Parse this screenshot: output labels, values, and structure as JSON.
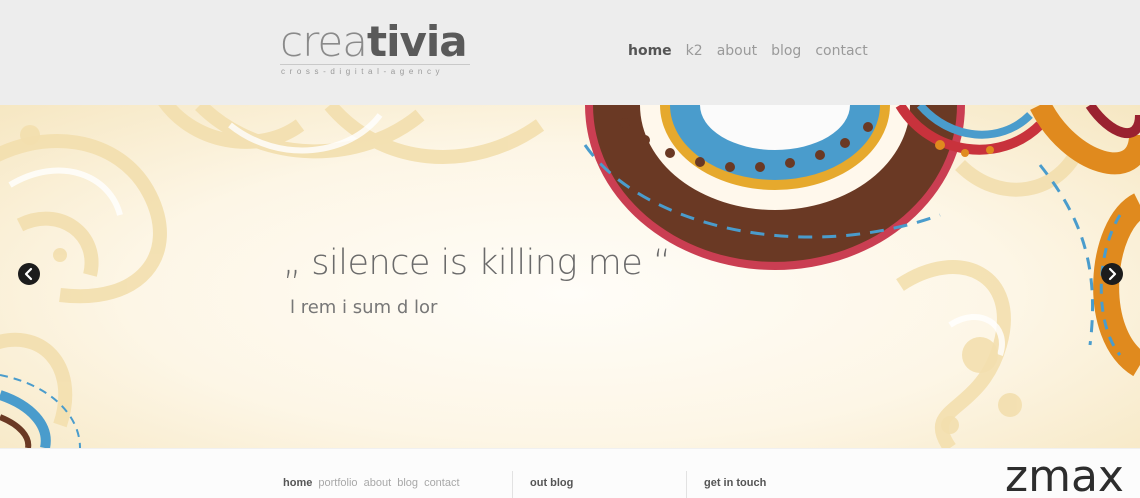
{
  "header": {
    "logo_light": "crea",
    "logo_bold": "tivia",
    "tagline": "cross-digital-agency"
  },
  "nav": {
    "items": [
      {
        "label": "home",
        "active": true
      },
      {
        "label": "k2",
        "active": false
      },
      {
        "label": "about",
        "active": false
      },
      {
        "label": "blog",
        "active": false
      },
      {
        "label": "contact",
        "active": false
      }
    ]
  },
  "hero": {
    "quote": "„ silence is killing me “",
    "subtitle": "l rem i sum d lor",
    "prev_icon": "chevron-left-icon",
    "next_icon": "chevron-right-icon"
  },
  "footer": {
    "nav": [
      {
        "label": "home",
        "active": true
      },
      {
        "label": "portfolio",
        "active": false
      },
      {
        "label": "about",
        "active": false
      },
      {
        "label": "blog",
        "active": false
      },
      {
        "label": "contact",
        "active": false
      }
    ],
    "blog_heading": "out blog",
    "contact_heading": "get in touch"
  },
  "watermark": "zmax",
  "colors": {
    "header_bg": "#ededed",
    "text_dark": "#555555",
    "text_light": "#9a9a9a",
    "hero_cream": "#f6e7c2",
    "deco_blue": "#4aa3d0",
    "deco_brown": "#6b3a22",
    "deco_orange": "#e08a1e",
    "deco_red": "#c8323c"
  }
}
